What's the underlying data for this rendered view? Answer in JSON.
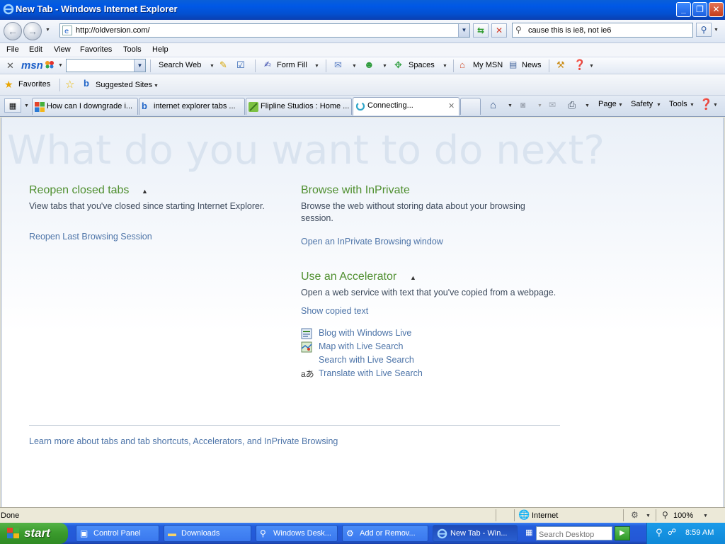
{
  "window": {
    "title": "New Tab - Windows Internet Explorer"
  },
  "address": {
    "url": "http://oldversion.com/"
  },
  "search": {
    "value": "cause this is ie8, not ie6"
  },
  "menu": [
    "File",
    "Edit",
    "View",
    "Favorites",
    "Tools",
    "Help"
  ],
  "msn_toolbar": {
    "logo": "msn",
    "search_web": "Search Web",
    "form_fill": "Form Fill",
    "spaces": "Spaces",
    "my_msn": "My MSN",
    "news": "News"
  },
  "favorites_bar": {
    "favorites": "Favorites",
    "suggested_sites": "Suggested Sites"
  },
  "tabs": [
    {
      "label": "How can I downgrade i..."
    },
    {
      "label": "internet explorer tabs ..."
    },
    {
      "label": "Flipline Studios : Home ..."
    },
    {
      "label": "Connecting..."
    }
  ],
  "command_bar": {
    "page": "Page",
    "safety": "Safety",
    "tools": "Tools"
  },
  "content": {
    "headline": "What do you want to do next?",
    "reopen": {
      "title": "Reopen closed tabs",
      "desc": "View tabs that you've closed since starting Internet Explorer.",
      "link": "Reopen Last Browsing Session"
    },
    "inprivate": {
      "title": "Browse with InPrivate",
      "desc_line1": "Browse the web without storing data about your browsing",
      "desc_line2": "session.",
      "link": "Open an InPrivate Browsing window"
    },
    "accelerator": {
      "title": "Use an Accelerator",
      "desc": "Open a web service with text that you've copied from a webpage.",
      "show": "Show copied text",
      "items": [
        "Blog with Windows Live",
        "Map with Live Search",
        "Search with Live Search",
        "Translate with Live Search"
      ]
    },
    "learn_more": "Learn more about tabs and tab shortcuts, Accelerators, and InPrivate Browsing"
  },
  "status": {
    "text": "Done",
    "zone": "Internet",
    "zoom": "100%"
  },
  "taskbar": {
    "start": "start",
    "tasks": [
      "Control Panel",
      "Downloads",
      "Windows Desk...",
      "Add or Remov...",
      "New Tab - Win..."
    ],
    "desktop_search_placeholder": "Search Desktop",
    "clock": "8:59 AM"
  }
}
